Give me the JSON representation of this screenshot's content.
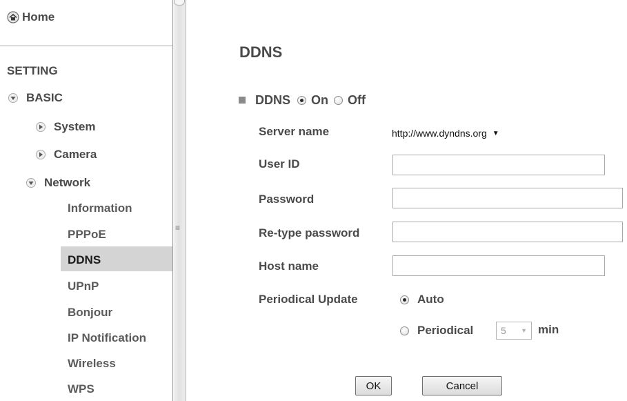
{
  "sidebar": {
    "home_label": "Home",
    "section_label": "SETTING",
    "basic_label": "BASIC",
    "items": [
      {
        "label": "System"
      },
      {
        "label": "Camera"
      },
      {
        "label": "Network"
      }
    ],
    "network_sub": [
      {
        "label": "Information"
      },
      {
        "label": "PPPoE"
      },
      {
        "label": "DDNS"
      },
      {
        "label": "UPnP"
      },
      {
        "label": "Bonjour"
      },
      {
        "label": "IP Notification"
      },
      {
        "label": "Wireless"
      },
      {
        "label": "WPS"
      }
    ],
    "active_item": "DDNS",
    "grip_glyph": "≡"
  },
  "main": {
    "title": "DDNS",
    "ddns_toggle": {
      "label": "DDNS",
      "on_label": "On",
      "off_label": "Off",
      "selected": "On"
    },
    "fields": {
      "server_name_label": "Server name",
      "server_name_value": "http://www.dyndns.org",
      "user_id_label": "User ID",
      "user_id_value": "",
      "password_label": "Password",
      "password_value": "",
      "retype_label": "Re-type password",
      "retype_value": "",
      "host_label": "Host name",
      "host_value": ""
    },
    "periodical_update": {
      "label": "Periodical Update",
      "auto_label": "Auto",
      "periodical_label": "Periodical",
      "selected": "Auto",
      "interval_value": "5",
      "unit_label": "min"
    },
    "buttons": {
      "ok_label": "OK",
      "cancel_label": "Cancel"
    }
  },
  "icons": {
    "home": "home-icon",
    "expanded": "arrow-down-icon",
    "collapsed": "arrow-right-icon"
  },
  "colors": {
    "text": "#4a4a4a",
    "active_highlight": "#d4d4d4"
  }
}
